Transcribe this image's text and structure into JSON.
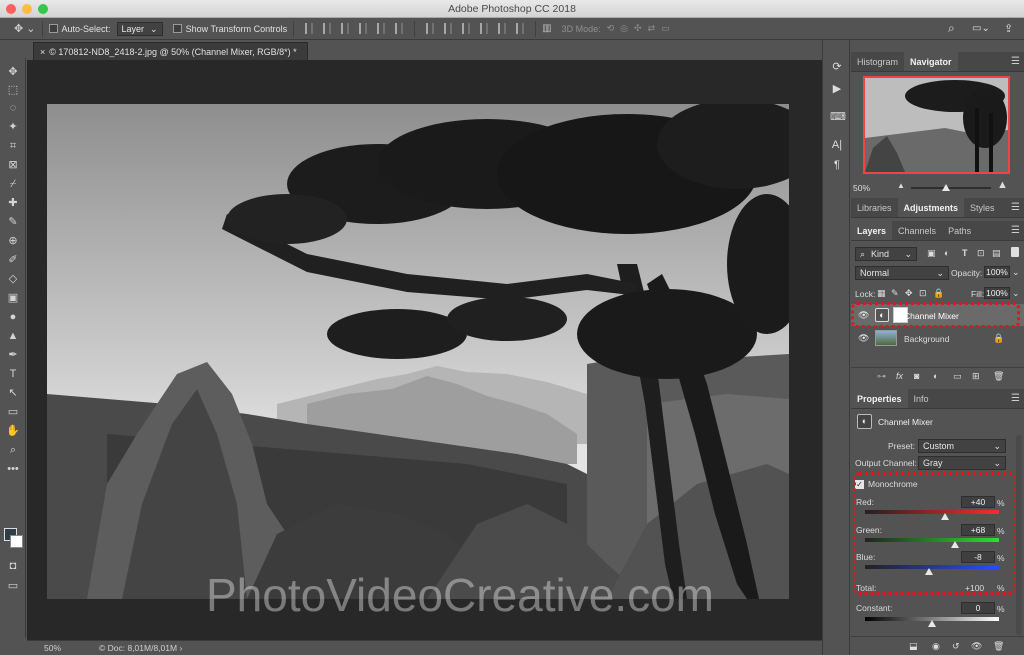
{
  "app": {
    "title": "Adobe Photoshop CC 2018",
    "doc_tab": "© 170812-ND8_2418-2.jpg @ 50% (Channel Mixer, RGB/8*) *"
  },
  "options_bar": {
    "auto_select_label": "Auto-Select:",
    "auto_select_value": "Layer",
    "show_transform_label": "Show Transform Controls",
    "mode_3d_label": "3D Mode:"
  },
  "status": {
    "zoom": "50%",
    "doc_size": "Doc: 8,01M/8,01M"
  },
  "watermark": "PhotoVideoCreative.com",
  "navigator": {
    "tabs": [
      "Histogram",
      "Navigator"
    ],
    "active_tab": "Navigator",
    "zoom": "50%"
  },
  "adjust_tabs": [
    "Libraries",
    "Adjustments",
    "Styles"
  ],
  "layers_panel": {
    "tabs": [
      "Layers",
      "Channels",
      "Paths"
    ],
    "kind_label": "Kind",
    "blend_mode": "Normal",
    "opacity_label": "Opacity:",
    "opacity_value": "100%",
    "lock_label": "Lock:",
    "fill_label": "Fill:",
    "fill_value": "100%",
    "layers": [
      {
        "name": "Channel Mixer"
      },
      {
        "name": "Background"
      }
    ]
  },
  "properties": {
    "tabs": [
      "Properties",
      "Info"
    ],
    "title": "Channel Mixer",
    "preset_label": "Preset:",
    "preset_value": "Custom",
    "output_label": "Output Channel:",
    "output_value": "Gray",
    "monochrome_label": "Monochrome",
    "monochrome_checked": true,
    "channels": [
      {
        "label": "Red:",
        "value": "+40",
        "level": 40,
        "unit": "%"
      },
      {
        "label": "Green:",
        "value": "+68",
        "level": 68,
        "unit": "%"
      },
      {
        "label": "Blue:",
        "value": "-8",
        "level": -8,
        "unit": "%"
      }
    ],
    "total_label": "Total:",
    "total_value": "+100",
    "total_unit": "%",
    "constant_label": "Constant:",
    "constant_value": "0",
    "constant_unit": "%"
  }
}
